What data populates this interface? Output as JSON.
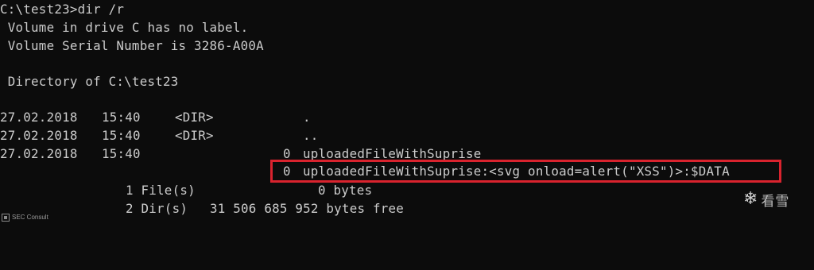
{
  "console": {
    "prompt_line": "C:\\test23>dir /r",
    "volume_label": " Volume in drive C has no label.",
    "serial": " Volume Serial Number is 3286-A00A",
    "directory_of": " Directory of C:\\test23",
    "entries": [
      {
        "date": "27.02.2018",
        "time": "15:40",
        "type": "<DIR>",
        "size": "",
        "name": "."
      },
      {
        "date": "27.02.2018",
        "time": "15:40",
        "type": "<DIR>",
        "size": "",
        "name": ".."
      },
      {
        "date": "27.02.2018",
        "time": "15:40",
        "type": "",
        "size": "0",
        "name": "uploadedFileWithSuprise"
      }
    ],
    "ads_stream": {
      "size": "0",
      "name": "uploadedFileWithSuprise:<svg onload=alert(\"XSS\")>:$DATA"
    },
    "summary_files": {
      "count": "1 File(s)",
      "bytes": "0 bytes"
    },
    "summary_dirs": {
      "count": "2 Dir(s)",
      "bytes": "31 506 685 952 bytes free"
    }
  },
  "watermarks": {
    "left_text": "SEC Consult",
    "right_text": "看雪",
    "right_icon": "snowflake-icon"
  },
  "colors": {
    "background": "#0c0c0c",
    "text": "#cccccc",
    "highlight": "#d9232e"
  }
}
